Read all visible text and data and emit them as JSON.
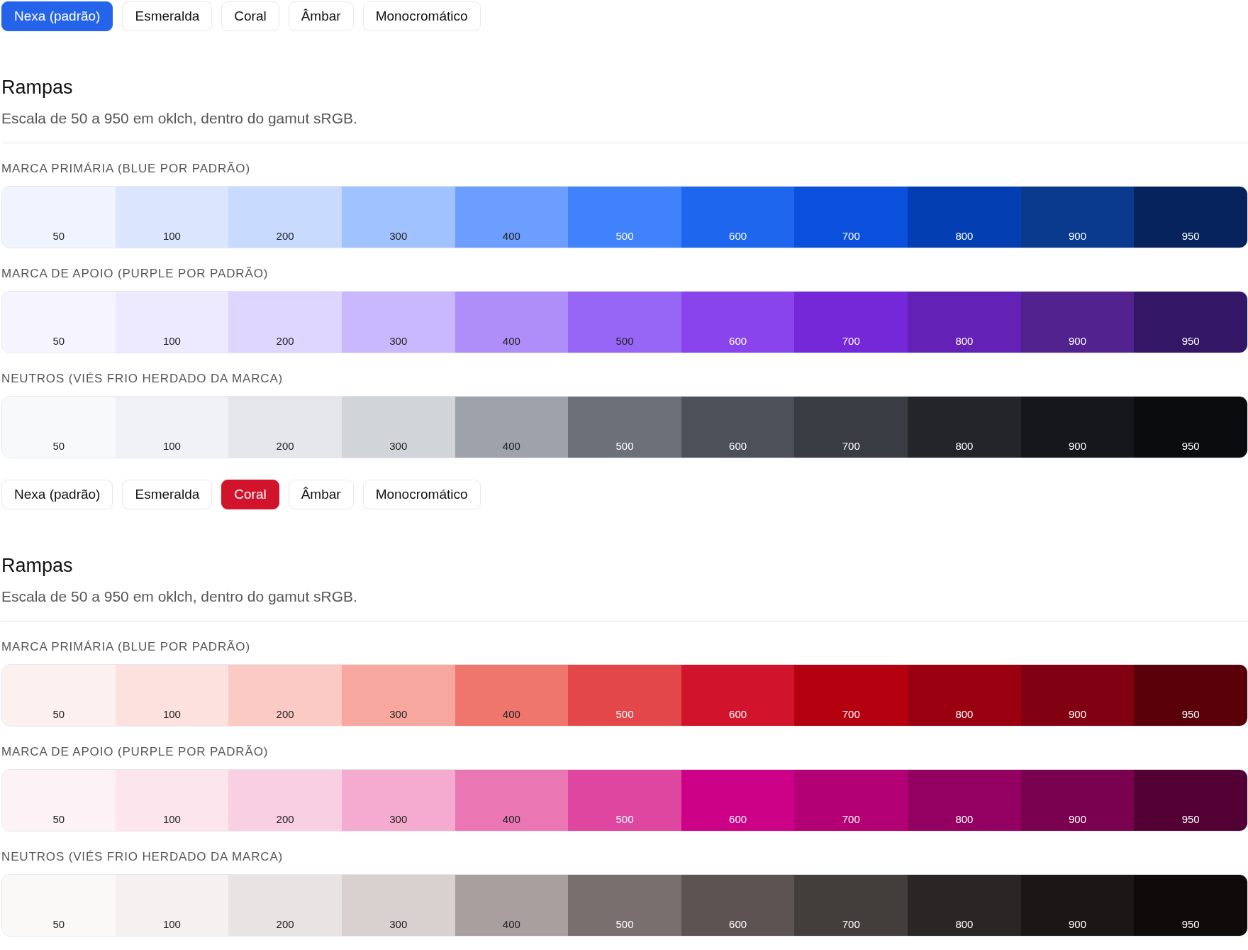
{
  "sections": [
    {
      "color": "#2563eb",
      "options": [
        {
          "label": "Nexa (padrão)",
          "selected": true
        },
        {
          "label": "Esmeralda",
          "selected": false
        },
        {
          "label": "Coral",
          "selected": false
        },
        {
          "label": "Âmbar",
          "selected": false
        },
        {
          "label": "Monocromático",
          "selected": false
        }
      ],
      "title": "Rampas",
      "subtitle": "Escala de 50 a 950 em oklch, dentro do gamut sRGB.",
      "ramps": [
        {
          "label": "MARCA PRIMÁRIA (BLUE POR PADRÃO)",
          "swatches": [
            {
              "label": "50",
              "color": "#eff4ff"
            },
            {
              "label": "100",
              "color": "#dbe6fe"
            },
            {
              "label": "200",
              "color": "#c8dafe"
            },
            {
              "label": "300",
              "color": "#a0c2fe"
            },
            {
              "label": "400",
              "color": "#6b9efe"
            },
            {
              "label": "500",
              "color": "#3f82fb"
            },
            {
              "label": "600",
              "color": "#1f66ee"
            },
            {
              "label": "700",
              "color": "#0b50dc"
            },
            {
              "label": "800",
              "color": "#043eb3"
            },
            {
              "label": "900",
              "color": "#0a3a8e"
            },
            {
              "label": "950",
              "color": "#06235e"
            }
          ]
        },
        {
          "label": "MARCA DE APOIO (PURPLE POR PADRÃO)",
          "swatches": [
            {
              "label": "50",
              "color": "#f6f4fe"
            },
            {
              "label": "100",
              "color": "#ede9fe"
            },
            {
              "label": "200",
              "color": "#ded6fe"
            },
            {
              "label": "300",
              "color": "#c9b8fd"
            },
            {
              "label": "400",
              "color": "#ae8ffa"
            },
            {
              "label": "500",
              "color": "#9866f6"
            },
            {
              "label": "600",
              "color": "#8944ec"
            },
            {
              "label": "700",
              "color": "#7528d8"
            },
            {
              "label": "800",
              "color": "#6321b6"
            },
            {
              "label": "900",
              "color": "#52228f"
            },
            {
              "label": "950",
              "color": "#331766"
            }
          ]
        },
        {
          "label": "NEUTROS (VIÉS FRIO HERDADO DA MARCA)",
          "swatches": [
            {
              "label": "50",
              "color": "#f8f9fb"
            },
            {
              "label": "100",
              "color": "#f1f2f5"
            },
            {
              "label": "200",
              "color": "#e4e6ea"
            },
            {
              "label": "300",
              "color": "#d1d4d9"
            },
            {
              "label": "400",
              "color": "#9ea2ab"
            },
            {
              "label": "500",
              "color": "#6b7079"
            },
            {
              "label": "600",
              "color": "#4c5059"
            },
            {
              "label": "700",
              "color": "#393c42"
            },
            {
              "label": "800",
              "color": "#232528"
            },
            {
              "label": "900",
              "color": "#16171a"
            },
            {
              "label": "950",
              "color": "#0b0c0e"
            }
          ]
        }
      ]
    },
    {
      "color": "#d1142b",
      "options": [
        {
          "label": "Nexa (padrão)",
          "selected": false
        },
        {
          "label": "Esmeralda",
          "selected": false
        },
        {
          "label": "Coral",
          "selected": true
        },
        {
          "label": "Âmbar",
          "selected": false
        },
        {
          "label": "Monocromático",
          "selected": false
        }
      ],
      "title": "Rampas",
      "subtitle": "Escala de 50 a 950 em oklch, dentro do gamut sRGB.",
      "ramps": [
        {
          "label": "MARCA PRIMÁRIA (BLUE POR PADRÃO)",
          "swatches": [
            {
              "label": "50",
              "color": "#fdf1f0"
            },
            {
              "label": "100",
              "color": "#fde1de"
            },
            {
              "label": "200",
              "color": "#fccac5"
            },
            {
              "label": "300",
              "color": "#f8a79f"
            },
            {
              "label": "400",
              "color": "#ef766c"
            },
            {
              "label": "500",
              "color": "#e4474a"
            },
            {
              "label": "600",
              "color": "#d1142b"
            },
            {
              "label": "700",
              "color": "#b5000f"
            },
            {
              "label": "800",
              "color": "#9a0010"
            },
            {
              "label": "900",
              "color": "#810012"
            },
            {
              "label": "950",
              "color": "#5a0008"
            }
          ]
        },
        {
          "label": "MARCA DE APOIO (PURPLE POR PADRÃO)",
          "swatches": [
            {
              "label": "50",
              "color": "#fdf2f5"
            },
            {
              "label": "100",
              "color": "#fce5ed"
            },
            {
              "label": "200",
              "color": "#f9d0e1"
            },
            {
              "label": "300",
              "color": "#f5abcf"
            },
            {
              "label": "400",
              "color": "#ea77b3"
            },
            {
              "label": "500",
              "color": "#df469f"
            },
            {
              "label": "600",
              "color": "#cd0088"
            },
            {
              "label": "700",
              "color": "#b30074"
            },
            {
              "label": "800",
              "color": "#940062"
            },
            {
              "label": "900",
              "color": "#7a0050"
            },
            {
              "label": "950",
              "color": "#530034"
            }
          ]
        },
        {
          "label": "NEUTROS (VIÉS FRIO HERDADO DA MARCA)",
          "swatches": [
            {
              "label": "50",
              "color": "#faf9f8"
            },
            {
              "label": "100",
              "color": "#f4f1f0"
            },
            {
              "label": "200",
              "color": "#e8e4e3"
            },
            {
              "label": "300",
              "color": "#d8d1d0"
            },
            {
              "label": "400",
              "color": "#a89f9e"
            },
            {
              "label": "500",
              "color": "#7a6f6f"
            },
            {
              "label": "600",
              "color": "#5c5352"
            },
            {
              "label": "700",
              "color": "#433d3c"
            },
            {
              "label": "800",
              "color": "#2a2625"
            },
            {
              "label": "900",
              "color": "#1a1716"
            },
            {
              "label": "950",
              "color": "#0f0b0a"
            }
          ]
        }
      ]
    }
  ]
}
